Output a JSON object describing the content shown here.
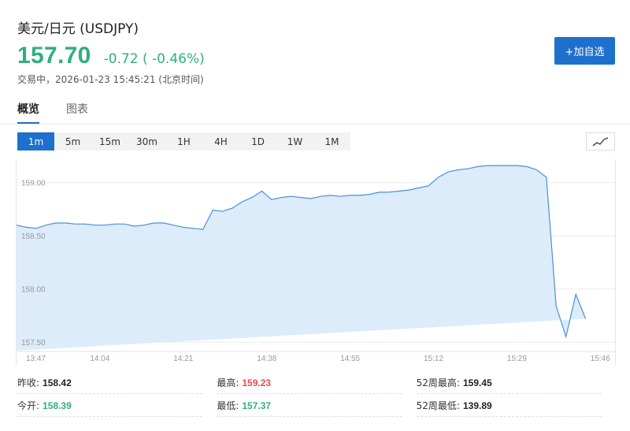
{
  "header": {
    "title": "美元/日元 (USDJPY)",
    "price": "157.70",
    "change": "-0.72 ( -0.46%)",
    "status": "交易中，2026-01-23 15:45:21 (北京时间)",
    "add_button_label": "+加自选"
  },
  "tabs": [
    {
      "label": "概览",
      "active": true
    },
    {
      "label": "图表",
      "active": false
    }
  ],
  "periods": [
    {
      "label": "1m",
      "active": true
    },
    {
      "label": "5m",
      "active": false
    },
    {
      "label": "15m",
      "active": false
    },
    {
      "label": "30m",
      "active": false
    },
    {
      "label": "1H",
      "active": false
    },
    {
      "label": "4H",
      "active": false
    },
    {
      "label": "1D",
      "active": false
    },
    {
      "label": "1W",
      "active": false
    },
    {
      "label": "1M",
      "active": false
    }
  ],
  "colors": {
    "up_green": "#2fb07d",
    "down_red": "#e84a4a",
    "accent_blue": "#1e70cd",
    "line": "#4a90d9",
    "fill": "#dcecfb"
  },
  "chart_toggle_icon": "line-chart-icon",
  "chart_data": {
    "type": "area",
    "ylim": [
      157.42,
      159.22
    ],
    "yticks": [
      "159.00",
      "158.50",
      "158.00",
      "157.50"
    ],
    "ytick_values": [
      159.0,
      158.5,
      158.0,
      157.5
    ],
    "xticks": [
      "13:47",
      "14:04",
      "14:21",
      "14:38",
      "14:55",
      "15:12",
      "15:29",
      "15:46"
    ],
    "x_minutes": [
      0,
      2,
      4,
      6,
      8,
      10,
      12,
      14,
      16,
      18,
      20,
      22,
      24,
      26,
      28,
      30,
      32,
      34,
      36,
      38,
      40,
      42,
      44,
      46,
      48,
      50,
      51,
      52,
      54,
      56,
      58,
      60,
      62,
      64,
      66,
      68,
      70,
      72,
      74,
      76,
      78,
      80,
      82,
      84,
      86,
      88,
      90,
      92,
      94,
      96,
      98,
      100,
      102,
      104,
      106,
      108,
      110,
      112,
      114,
      116,
      118,
      120,
      121,
      122
    ],
    "values": [
      158.6,
      158.58,
      158.57,
      158.6,
      158.62,
      158.62,
      158.61,
      158.61,
      158.6,
      158.6,
      158.61,
      158.61,
      158.59,
      158.6,
      158.62,
      158.62,
      158.6,
      158.58,
      158.57,
      158.56,
      158.74,
      158.73,
      158.76,
      158.82,
      158.86,
      158.92,
      158.88,
      158.84,
      158.86,
      158.87,
      158.86,
      158.85,
      158.87,
      158.88,
      158.87,
      158.88,
      158.88,
      158.89,
      158.91,
      158.91,
      158.92,
      158.93,
      158.95,
      158.97,
      159.05,
      159.1,
      159.12,
      159.13,
      159.15,
      159.16,
      159.16,
      159.16,
      159.16,
      159.15,
      159.12,
      159.05,
      157.84,
      157.55,
      157.95,
      157.72
    ]
  },
  "stats": [
    [
      {
        "label": "昨收:",
        "value": "158.42",
        "tone": "normal"
      },
      {
        "label": "最高:",
        "value": "159.23",
        "tone": "red"
      },
      {
        "label": "52周最高:",
        "value": "159.45",
        "tone": "normal"
      }
    ],
    [
      {
        "label": "今开:",
        "value": "158.39",
        "tone": "green"
      },
      {
        "label": "最低:",
        "value": "157.37",
        "tone": "green"
      },
      {
        "label": "52周最低:",
        "value": "139.89",
        "tone": "normal"
      }
    ]
  ]
}
